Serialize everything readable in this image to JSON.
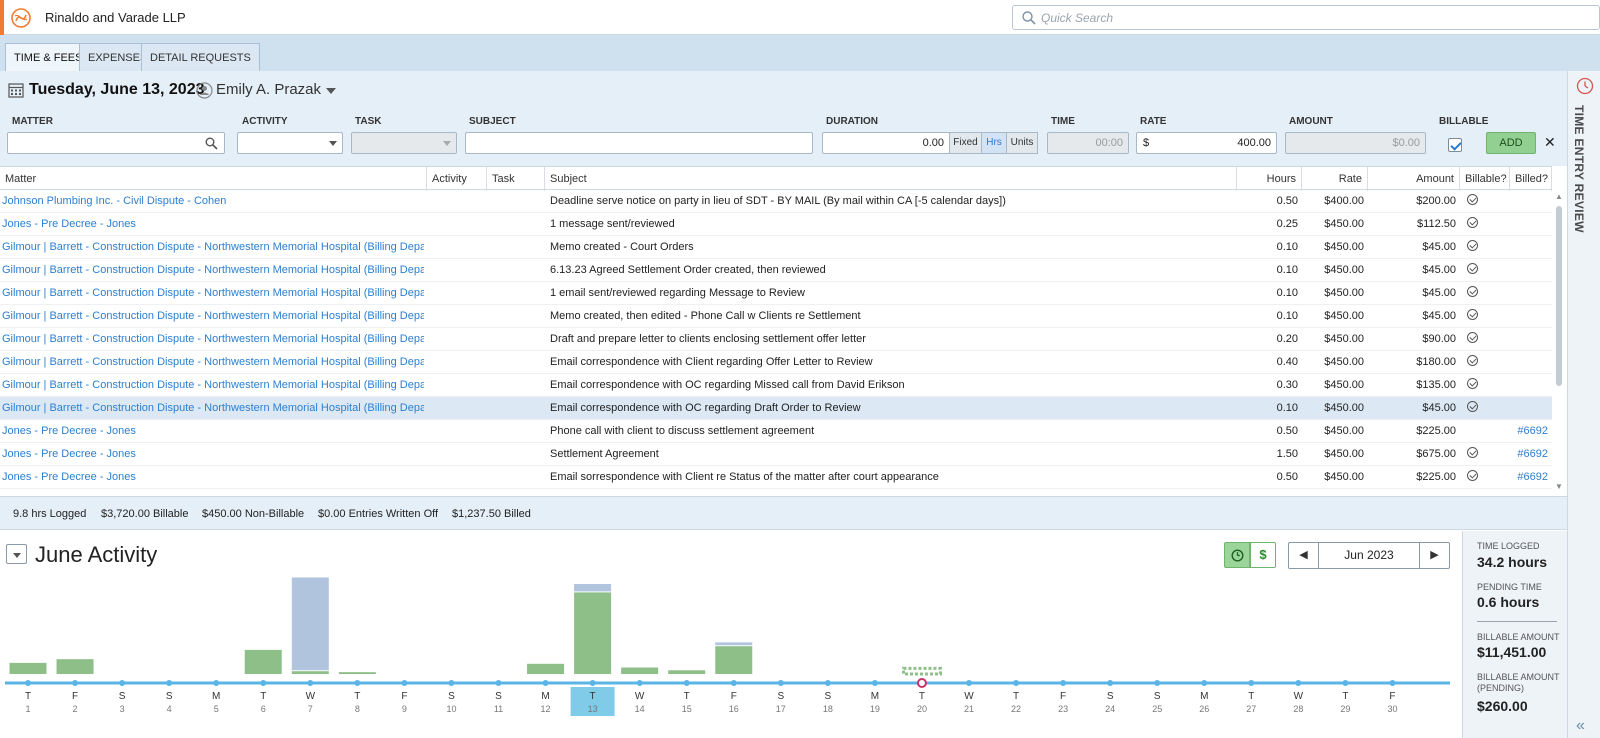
{
  "app": {
    "firm_name": "Rinaldo and Varade LLP",
    "search_placeholder": "Quick Search"
  },
  "tabs": [
    {
      "label": "TIME & FEES",
      "active": true
    },
    {
      "label": "EXPENSES",
      "active": false
    },
    {
      "label": "DETAIL REQUESTS",
      "active": false
    }
  ],
  "header": {
    "date": "Tuesday, June 13, 2023",
    "user": "Emily A. Prazak"
  },
  "form": {
    "matter_label": "MATTER",
    "activity_label": "ACTIVITY",
    "task_label": "TASK",
    "subject_label": "SUBJECT",
    "duration_label": "DURATION",
    "duration_value": "0.00",
    "fixed_label": "Fixed",
    "hrs_label": "Hrs",
    "units_label": "Units",
    "time_label": "TIME",
    "time_value": "00:00",
    "rate_label": "RATE",
    "rate_prefix": "$",
    "rate_value": "400.00",
    "amount_label": "AMOUNT",
    "amount_value": "$0.00",
    "billable_label": "BILLABLE",
    "add_label": "ADD",
    "clear_label": "✕"
  },
  "table": {
    "columns": [
      "Matter",
      "Activity",
      "Task",
      "Subject",
      "Hours",
      "Rate",
      "Amount",
      "Billable?",
      "Billed?"
    ],
    "rows": [
      {
        "matter": "Johnson Plumbing Inc. - Civil Dispute - Cohen",
        "subject": "Deadline serve notice on party in lieu of SDT - BY MAIL (By mail within CA [-5 calendar days])",
        "hours": "0.50",
        "rate": "$400.00",
        "amount": "$200.00",
        "billable": true,
        "billed": "",
        "selected": false
      },
      {
        "matter": "Jones - Pre Decree - Jones",
        "subject": "1 message sent/reviewed",
        "hours": "0.25",
        "rate": "$450.00",
        "amount": "$112.50",
        "billable": true,
        "billed": "",
        "selected": false
      },
      {
        "matter": "Gilmour | Barrett - Construction Dispute - Northwestern Memorial Hospital (Billing Depa",
        "subject": "Memo created - Court Orders",
        "hours": "0.10",
        "rate": "$450.00",
        "amount": "$45.00",
        "billable": true,
        "billed": "",
        "selected": false
      },
      {
        "matter": "Gilmour | Barrett - Construction Dispute - Northwestern Memorial Hospital (Billing Depa",
        "subject": "6.13.23 Agreed Settlement Order created, then reviewed",
        "hours": "0.10",
        "rate": "$450.00",
        "amount": "$45.00",
        "billable": true,
        "billed": "",
        "selected": false
      },
      {
        "matter": "Gilmour | Barrett - Construction Dispute - Northwestern Memorial Hospital (Billing Depa",
        "subject": "1 email sent/reviewed regarding Message to Review",
        "hours": "0.10",
        "rate": "$450.00",
        "amount": "$45.00",
        "billable": true,
        "billed": "",
        "selected": false
      },
      {
        "matter": "Gilmour | Barrett - Construction Dispute - Northwestern Memorial Hospital (Billing Depa",
        "subject": "Memo created, then edited - Phone Call w Clients re Settlement",
        "hours": "0.10",
        "rate": "$450.00",
        "amount": "$45.00",
        "billable": true,
        "billed": "",
        "selected": false
      },
      {
        "matter": "Gilmour | Barrett - Construction Dispute - Northwestern Memorial Hospital (Billing Depa",
        "subject": "Draft and prepare letter to clients enclosing settlement offer letter",
        "hours": "0.20",
        "rate": "$450.00",
        "amount": "$90.00",
        "billable": true,
        "billed": "",
        "selected": false
      },
      {
        "matter": "Gilmour | Barrett - Construction Dispute - Northwestern Memorial Hospital (Billing Depa",
        "subject": "Email correspondence with Client regarding Offer Letter to Review",
        "hours": "0.40",
        "rate": "$450.00",
        "amount": "$180.00",
        "billable": true,
        "billed": "",
        "selected": false
      },
      {
        "matter": "Gilmour | Barrett - Construction Dispute - Northwestern Memorial Hospital (Billing Depa",
        "subject": "Email correspondence with OC  regarding Missed call from David Erikson",
        "hours": "0.30",
        "rate": "$450.00",
        "amount": "$135.00",
        "billable": true,
        "billed": "",
        "selected": false
      },
      {
        "matter": "Gilmour | Barrett - Construction Dispute - Northwestern Memorial Hospital (Billing Depa",
        "subject": "Email correspondence with OC regarding Draft Order to Review",
        "hours": "0.10",
        "rate": "$450.00",
        "amount": "$45.00",
        "billable": true,
        "billed": "",
        "selected": true
      },
      {
        "matter": "Jones - Pre Decree - Jones",
        "subject": "Phone call with client to discuss settlement agreement",
        "hours": "0.50",
        "rate": "$450.00",
        "amount": "$225.00",
        "billable": false,
        "billed": "#6692",
        "selected": false
      },
      {
        "matter": "Jones - Pre Decree - Jones",
        "subject": "Settlement Agreement",
        "hours": "1.50",
        "rate": "$450.00",
        "amount": "$675.00",
        "billable": true,
        "billed": "#6692",
        "selected": false
      },
      {
        "matter": "Jones - Pre Decree - Jones",
        "subject": "Email sorrespondence with Client re Status of the matter after court appearance",
        "hours": "0.50",
        "rate": "$450.00",
        "amount": "$225.00",
        "billable": true,
        "billed": "#6692",
        "selected": false
      }
    ]
  },
  "summary": {
    "logged": "9.8 hrs Logged",
    "billable": "$3,720.00 Billable",
    "non_billable": "$450.00 Non-Billable",
    "written_off": "$0.00 Entries Written Off",
    "billed": "$1,237.50 Billed"
  },
  "activity": {
    "title": "June Activity",
    "dollar_label": "$",
    "month": "Jun 2023"
  },
  "side_panel": {
    "label": "TIME ENTRY REVIEW",
    "collapse_label": "«"
  },
  "stats": {
    "time_logged_label": "TIME LOGGED",
    "time_logged_value": "34.2 hours",
    "pending_time_label": "PENDING TIME",
    "pending_time_value": "0.6 hours",
    "billable_amount_label": "BILLABLE AMOUNT",
    "billable_amount_value": "$11,451.00",
    "billable_pending_label": "BILLABLE AMOUNT (PENDING)",
    "billable_pending_value": "$260.00"
  },
  "colors": {
    "accent": "#f07c34",
    "link": "#2c7fd1",
    "billable_bar": "#8fbf88",
    "nonbillable_bar": "#b0c4de",
    "today_highlight": "#7fcbe8",
    "timeline": "#5ab4e6"
  },
  "chart_data": {
    "type": "bar",
    "title": "June Activity",
    "stacked": true,
    "days": [
      {
        "dow": "T",
        "day": "1",
        "billable": 1.2,
        "nonbillable": 0
      },
      {
        "dow": "F",
        "day": "2",
        "billable": 1.6,
        "nonbillable": 0
      },
      {
        "dow": "S",
        "day": "3",
        "billable": 0,
        "nonbillable": 0
      },
      {
        "dow": "S",
        "day": "4",
        "billable": 0,
        "nonbillable": 0
      },
      {
        "dow": "M",
        "day": "5",
        "billable": 0,
        "nonbillable": 0
      },
      {
        "dow": "T",
        "day": "6",
        "billable": 2.6,
        "nonbillable": 0
      },
      {
        "dow": "W",
        "day": "7",
        "billable": 0.3,
        "nonbillable": 10.0
      },
      {
        "dow": "T",
        "day": "8",
        "billable": 0.2,
        "nonbillable": 0
      },
      {
        "dow": "F",
        "day": "9",
        "billable": 0,
        "nonbillable": 0
      },
      {
        "dow": "S",
        "day": "10",
        "billable": 0,
        "nonbillable": 0
      },
      {
        "dow": "S",
        "day": "11",
        "billable": 0,
        "nonbillable": 0
      },
      {
        "dow": "M",
        "day": "12",
        "billable": 1.1,
        "nonbillable": 0
      },
      {
        "dow": "T",
        "day": "13",
        "billable": 8.8,
        "nonbillable": 0.8,
        "today": true
      },
      {
        "dow": "W",
        "day": "14",
        "billable": 0.7,
        "nonbillable": 0
      },
      {
        "dow": "T",
        "day": "15",
        "billable": 0.4,
        "nonbillable": 0
      },
      {
        "dow": "F",
        "day": "16",
        "billable": 3.0,
        "nonbillable": 0.3
      },
      {
        "dow": "S",
        "day": "17",
        "billable": 0,
        "nonbillable": 0
      },
      {
        "dow": "S",
        "day": "18",
        "billable": 0,
        "nonbillable": 0
      },
      {
        "dow": "M",
        "day": "19",
        "billable": 0,
        "nonbillable": 0
      },
      {
        "dow": "T",
        "day": "20",
        "billable": 0,
        "nonbillable": 0,
        "pending": 0.6,
        "marker": true
      },
      {
        "dow": "W",
        "day": "21",
        "billable": 0,
        "nonbillable": 0
      },
      {
        "dow": "T",
        "day": "22",
        "billable": 0,
        "nonbillable": 0
      },
      {
        "dow": "F",
        "day": "23",
        "billable": 0,
        "nonbillable": 0
      },
      {
        "dow": "S",
        "day": "24",
        "billable": 0,
        "nonbillable": 0
      },
      {
        "dow": "S",
        "day": "25",
        "billable": 0,
        "nonbillable": 0
      },
      {
        "dow": "M",
        "day": "26",
        "billable": 0,
        "nonbillable": 0
      },
      {
        "dow": "T",
        "day": "27",
        "billable": 0,
        "nonbillable": 0
      },
      {
        "dow": "W",
        "day": "28",
        "billable": 0,
        "nonbillable": 0
      },
      {
        "dow": "T",
        "day": "29",
        "billable": 0,
        "nonbillable": 0
      },
      {
        "dow": "F",
        "day": "30",
        "billable": 0,
        "nonbillable": 0
      }
    ],
    "ylim": [
      0,
      11
    ]
  }
}
